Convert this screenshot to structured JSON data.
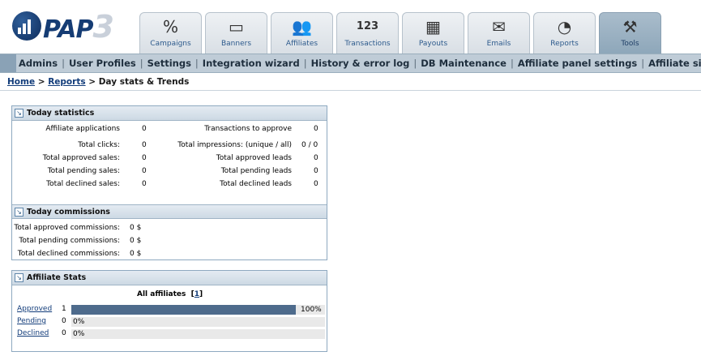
{
  "logo": {
    "name": "PAP",
    "version": "3"
  },
  "tabs": [
    {
      "label": "Campaigns",
      "icon": "percent-icon",
      "glyph": "%"
    },
    {
      "label": "Banners",
      "icon": "banner-icon",
      "glyph": "▭"
    },
    {
      "label": "Affiliates",
      "icon": "people-icon",
      "glyph": "👥"
    },
    {
      "label": "Transactions",
      "icon": "numbers-icon",
      "glyph": "123"
    },
    {
      "label": "Payouts",
      "icon": "calculator-icon",
      "glyph": "▦"
    },
    {
      "label": "Emails",
      "icon": "envelope-icon",
      "glyph": "✉"
    },
    {
      "label": "Reports",
      "icon": "pie-chart-icon",
      "glyph": "◔"
    },
    {
      "label": "Tools",
      "icon": "tools-icon",
      "glyph": "⚒"
    }
  ],
  "active_tab": "Tools",
  "subnav": [
    "Admins",
    "User Profiles",
    "Settings",
    "Integration wizard",
    "History & error log",
    "DB Maintenance",
    "Affiliate panel settings",
    "Affiliate signup settings"
  ],
  "breadcrumb": {
    "home": "Home",
    "reports": "Reports",
    "separator": ">",
    "current": "Day stats & Trends"
  },
  "today_statistics": {
    "title": "Today statistics",
    "left": [
      {
        "label": "Affiliate applications",
        "value": "0"
      },
      {
        "label": "Total clicks:",
        "value": "0"
      },
      {
        "label": "Total approved sales:",
        "value": "0"
      },
      {
        "label": "Total pending sales:",
        "value": "0"
      },
      {
        "label": "Total declined sales:",
        "value": "0"
      }
    ],
    "right": [
      {
        "label": "Transactions to approve",
        "value": "0"
      },
      {
        "label": "Total impressions: (unique / all)",
        "value": "0 / 0"
      },
      {
        "label": "Total approved leads",
        "value": "0"
      },
      {
        "label": "Total pending leads",
        "value": "0"
      },
      {
        "label": "Total declined leads",
        "value": "0"
      }
    ]
  },
  "today_commissions": {
    "title": "Today commissions",
    "rows": [
      {
        "label": "Total approved commissions:",
        "value": "0 $"
      },
      {
        "label": "Total pending commissions:",
        "value": "0 $"
      },
      {
        "label": "Total declined commissions:",
        "value": "0 $"
      }
    ]
  },
  "affiliate_stats": {
    "title": "Affiliate Stats",
    "heading": "All affiliates",
    "total_link": "1",
    "rows": [
      {
        "label": "Approved",
        "count": "1",
        "percent_text": "100%",
        "fraction": 1.0
      },
      {
        "label": "Pending",
        "count": "0",
        "percent_text": "0%",
        "fraction": 0.0
      },
      {
        "label": "Declined",
        "count": "0",
        "percent_text": "0%",
        "fraction": 0.0
      }
    ]
  },
  "colors": {
    "bar_fill": "#4e6b8c",
    "bar_track": "#e9e9e9",
    "link": "#123c7a",
    "subnav_bg": "#bfccd7"
  }
}
